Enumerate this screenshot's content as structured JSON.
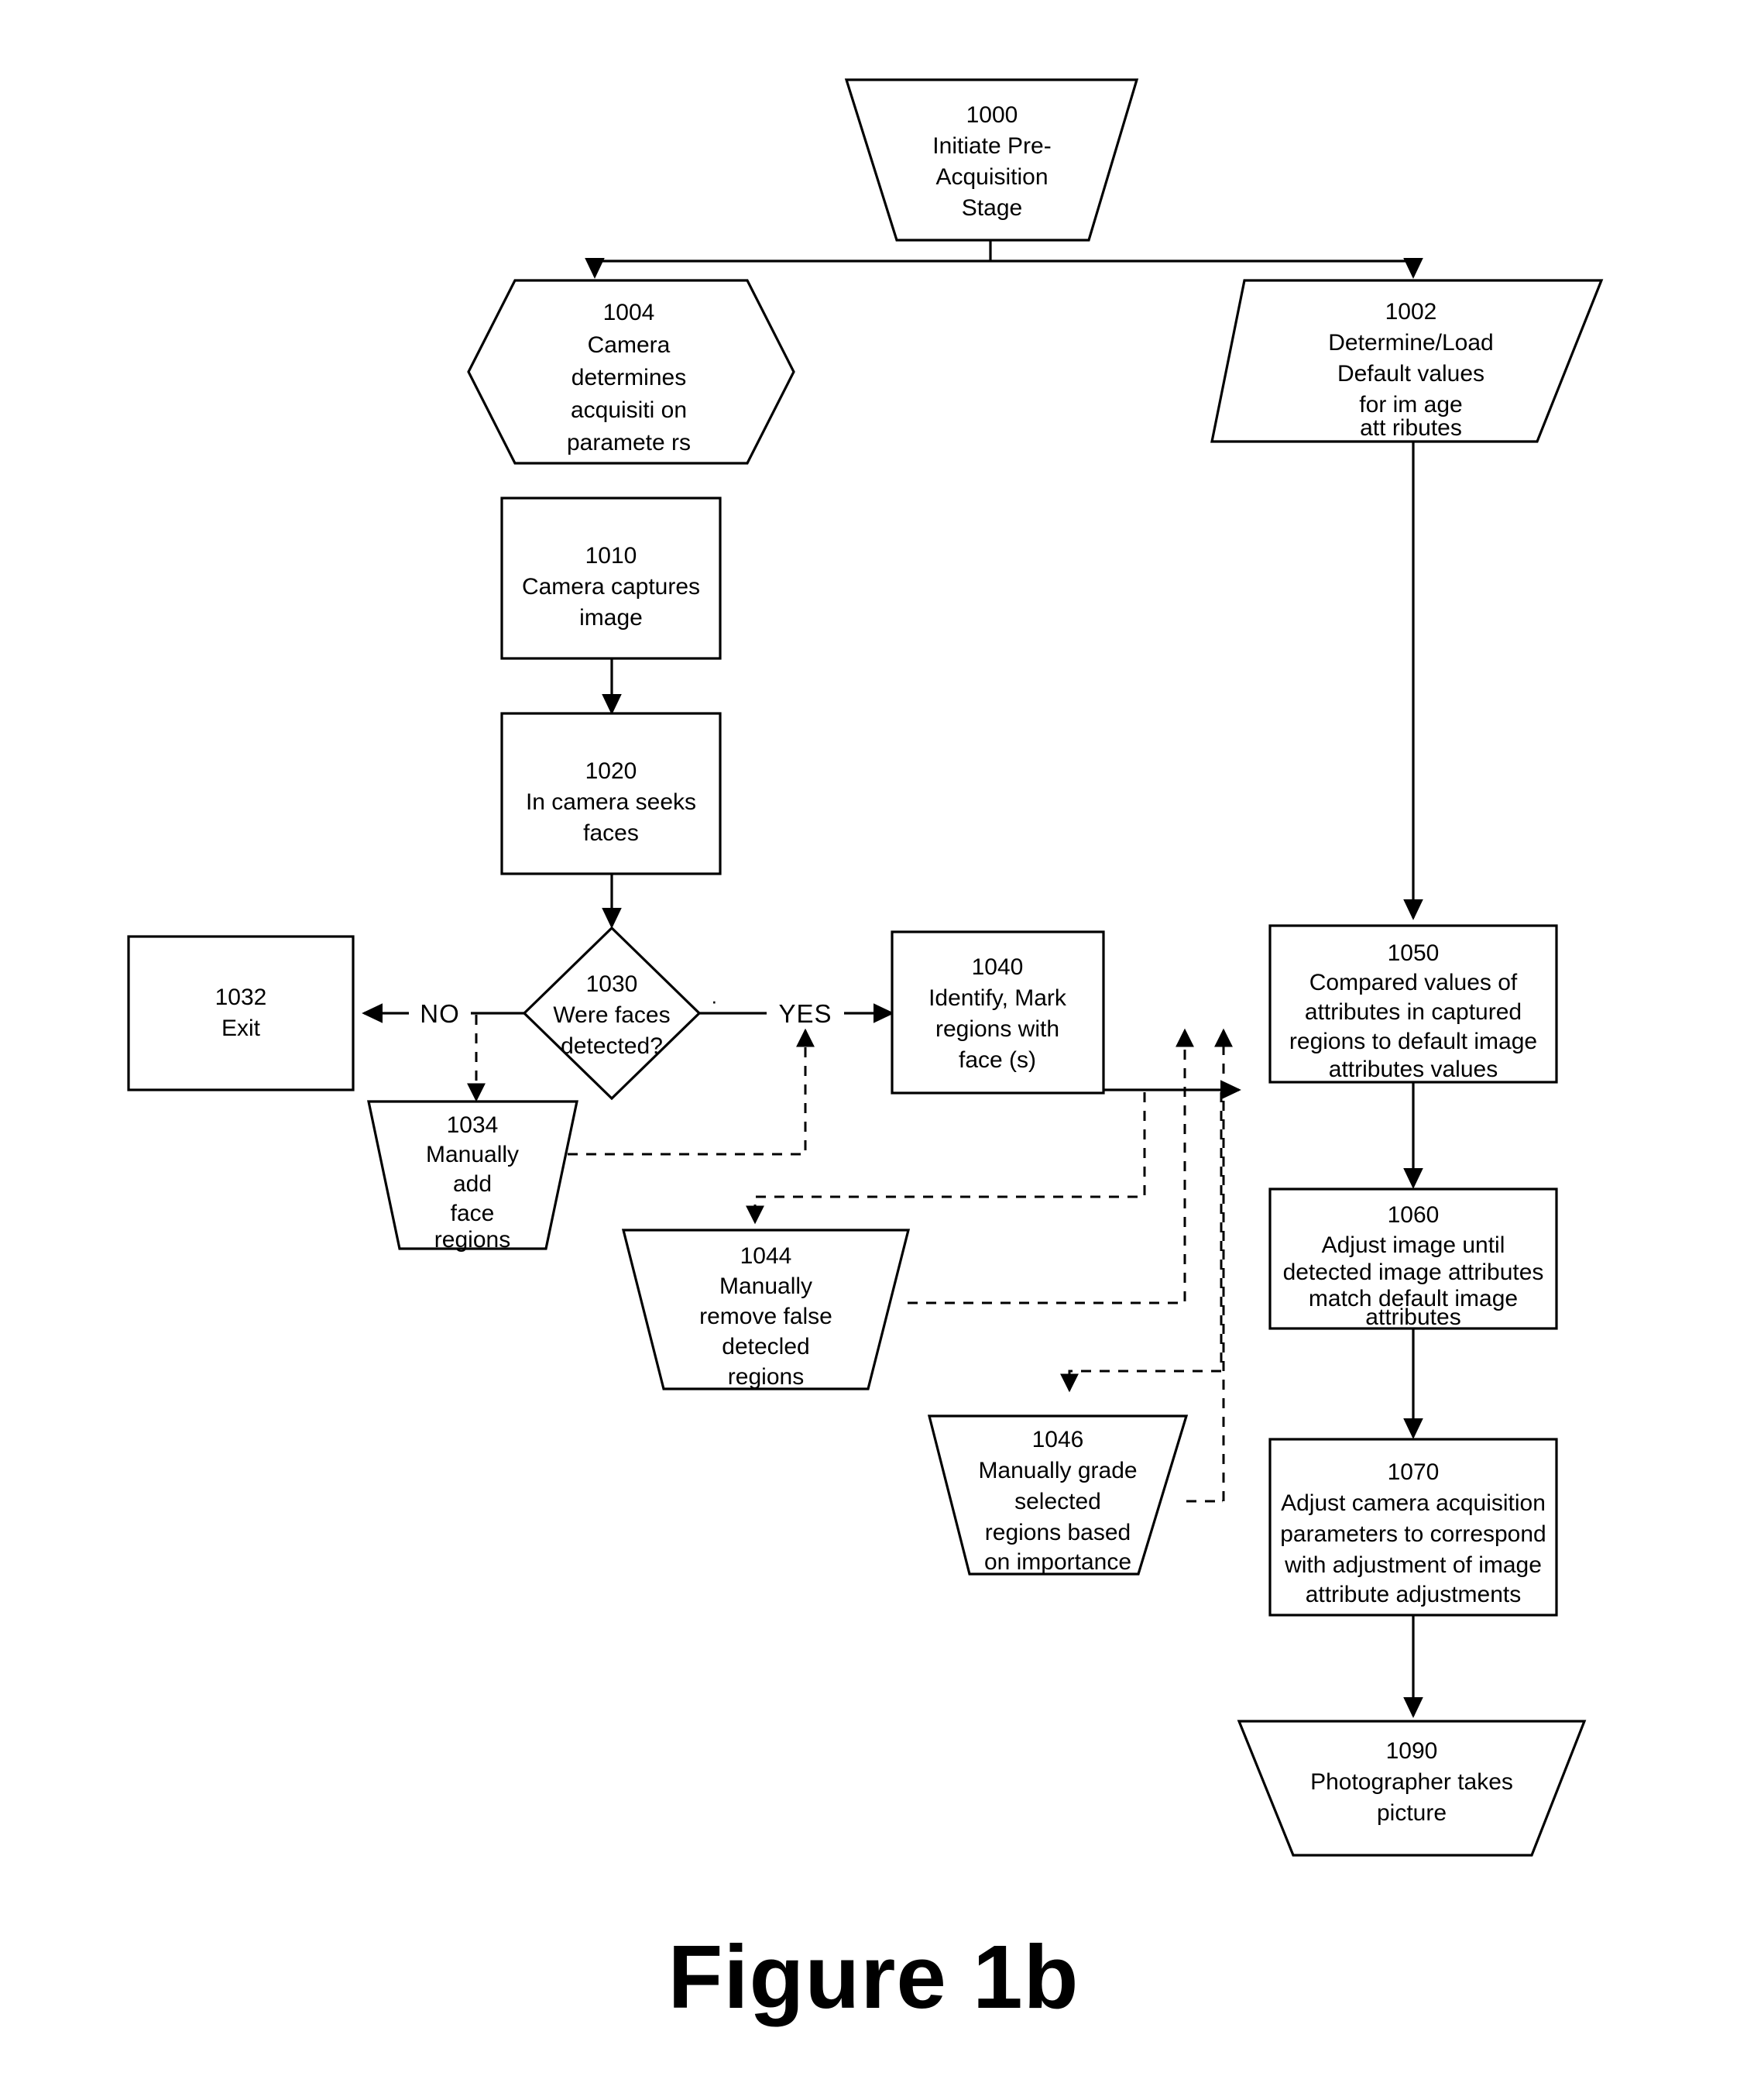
{
  "figure": {
    "caption": "Figure 1b"
  },
  "diagram": {
    "type": "flowchart",
    "title": "Pre-Acquisition Stage face-detection flow",
    "nodes": [
      {
        "id": "1000",
        "shape": "trapezoid-down",
        "number": "1000",
        "lines": [
          {
            "text": "Initiate Pre-",
            "italic": false
          },
          {
            "text": "Acquisition",
            "italic": false
          },
          {
            "text": "Stage",
            "italic": false
          }
        ]
      },
      {
        "id": "1004",
        "shape": "hexagon",
        "number": "1004",
        "lines": [
          {
            "text": "Camera",
            "italic": false
          },
          {
            "text": "determines",
            "italic": false
          },
          {
            "text": "acquisiti on",
            "italic": false
          },
          {
            "text": "paramete  rs",
            "italic": true
          }
        ]
      },
      {
        "id": "1002",
        "shape": "parallelogram",
        "number": "1002",
        "lines": [
          {
            "text": "Determine/Load",
            "italic": false
          },
          {
            "text": "Default values",
            "italic": false
          },
          {
            "text": "for  im age",
            "italic": false
          },
          {
            "text": "att ributes",
            "italic": false
          }
        ]
      },
      {
        "id": "1010",
        "shape": "rect",
        "number": "1010",
        "lines": [
          {
            "text": "Camera captures",
            "italic": false
          },
          {
            "text": "image",
            "italic": false
          }
        ]
      },
      {
        "id": "1020",
        "shape": "rect",
        "number": "1020",
        "lines": [
          {
            "text": "In camera seeks",
            "italic": false
          },
          {
            "text": "faces",
            "italic": false
          }
        ]
      },
      {
        "id": "1030",
        "shape": "diamond",
        "number": "1030",
        "lines": [
          {
            "text": "Were faces",
            "italic": false
          },
          {
            "text": "detected?",
            "italic": false
          }
        ]
      },
      {
        "id": "1032",
        "shape": "rect",
        "number": "1032",
        "lines": [
          {
            "text": "Exit",
            "italic": false
          }
        ]
      },
      {
        "id": "1034",
        "shape": "trapezoid-down",
        "number": "1034",
        "lines": [
          {
            "text": "Manually",
            "italic": false
          },
          {
            "text": "add",
            "italic": false
          },
          {
            "text": "face",
            "italic": false
          },
          {
            "text": "regions",
            "italic": false
          }
        ]
      },
      {
        "id": "1040",
        "shape": "rect",
        "number": "1040",
        "lines": [
          {
            "text": "Identify, Mark",
            "italic": false
          },
          {
            "text": "regions with",
            "italic": false
          },
          {
            "text": "face (s)",
            "italic": true
          }
        ]
      },
      {
        "id": "1044",
        "shape": "trapezoid-down",
        "number": "1044",
        "lines": [
          {
            "text": "Manually",
            "italic": false
          },
          {
            "text": "remove false",
            "italic": true
          },
          {
            "text": "detecled",
            "italic": false
          },
          {
            "text": "regions",
            "italic": false
          }
        ]
      },
      {
        "id": "1046",
        "shape": "trapezoid-down",
        "number": "1046",
        "lines": [
          {
            "text": "Manually grade",
            "italic": false
          },
          {
            "text": "selected",
            "italic": true
          },
          {
            "text": "regions based",
            "italic": false
          },
          {
            "text": "on importance",
            "italic": false
          }
        ]
      },
      {
        "id": "1050",
        "shape": "rect",
        "number": "1050",
        "lines": [
          {
            "text": "Compared values of",
            "italic": false
          },
          {
            "text": "attributes in captured",
            "italic": false
          },
          {
            "text": "regions to default image",
            "italic": false
          },
          {
            "text": "attributes values",
            "italic": false
          }
        ]
      },
      {
        "id": "1060",
        "shape": "rect",
        "number": "1060",
        "lines": [
          {
            "text": "Adjust image until",
            "italic": true
          },
          {
            "text": "detected image attributes",
            "italic": false
          },
          {
            "text": "match  default image",
            "italic": false
          },
          {
            "text": "attributes",
            "italic": false
          }
        ]
      },
      {
        "id": "1070",
        "shape": "rect",
        "number": "1070",
        "lines": [
          {
            "text": "Adjust camera acquisition",
            "italic": false
          },
          {
            "text": "parameters to correspond",
            "italic": false
          },
          {
            "text": "with  adjustment of image",
            "italic": false
          },
          {
            "text": "attribute adjustments",
            "italic": false
          }
        ]
      },
      {
        "id": "1090",
        "shape": "trapezoid-down",
        "number": "1090",
        "lines": [
          {
            "text": "Photographer takes",
            "italic": false
          },
          {
            "text": "picture",
            "italic": false
          }
        ]
      }
    ],
    "edge_labels": [
      {
        "id": "no",
        "text": "NO"
      },
      {
        "id": "yes",
        "text": "YES"
      }
    ],
    "edges": [
      {
        "from": "1000",
        "to": "1004",
        "style": "solid"
      },
      {
        "from": "1000",
        "to": "1002",
        "style": "solid"
      },
      {
        "from": "1010",
        "to": "1020",
        "style": "solid"
      },
      {
        "from": "1020",
        "to": "1030",
        "style": "solid"
      },
      {
        "from": "1030",
        "to": "1032",
        "style": "solid",
        "label": "NO"
      },
      {
        "from": "1030",
        "to": "1040",
        "style": "solid",
        "label": "YES"
      },
      {
        "from": "1030",
        "to": "1034",
        "style": "dashed"
      },
      {
        "from": "1034",
        "to": "1030-yes-branch",
        "style": "dashed"
      },
      {
        "from": "1002",
        "to": "1050",
        "style": "solid"
      },
      {
        "from": "1040",
        "to": "1050",
        "style": "solid"
      },
      {
        "from": "1040",
        "to": "1044",
        "style": "dashed"
      },
      {
        "from": "1044",
        "to": "1050-input",
        "style": "dashed"
      },
      {
        "from": "1044",
        "to": "1046",
        "style": "dashed"
      },
      {
        "from": "1046",
        "to": "1050-input",
        "style": "dashed"
      },
      {
        "from": "1050",
        "to": "1060",
        "style": "solid"
      },
      {
        "from": "1060",
        "to": "1070",
        "style": "solid"
      },
      {
        "from": "1070",
        "to": "1090",
        "style": "solid"
      }
    ]
  }
}
